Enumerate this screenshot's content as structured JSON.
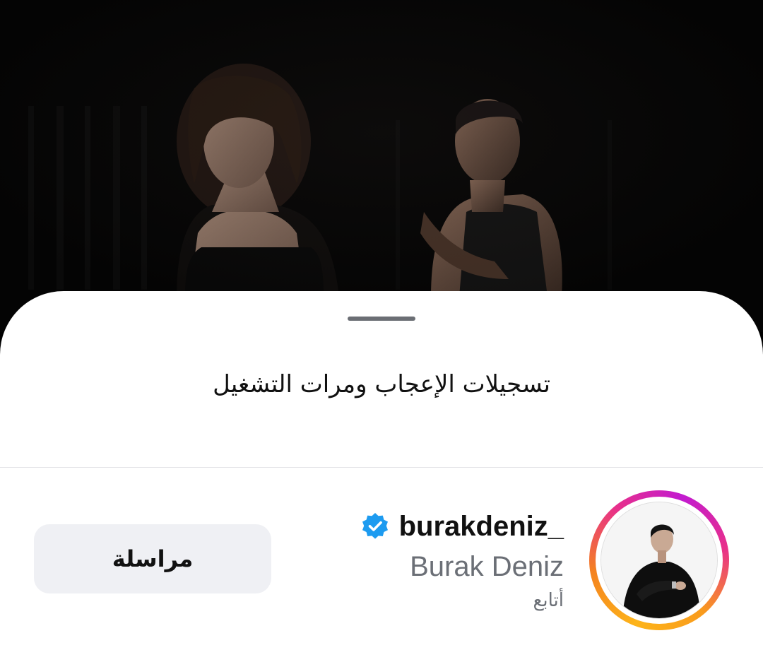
{
  "sheet": {
    "title": "تسجيلات الإعجاب ومرات التشغيل"
  },
  "profile": {
    "username": "burakdeniz_",
    "full_name": "Burak Deniz",
    "follow_status": "أتابع",
    "verified": true
  },
  "actions": {
    "message_label": "مراسلة"
  },
  "icons": {
    "verified": "verified-badge-icon",
    "avatar": "profile-avatar"
  },
  "colors": {
    "verified_blue": "#1d9bf0",
    "ring_start": "#fdb41a",
    "ring_end": "#c21bd0",
    "secondary_text": "#6b6f76",
    "button_bg": "#eff0f4"
  }
}
